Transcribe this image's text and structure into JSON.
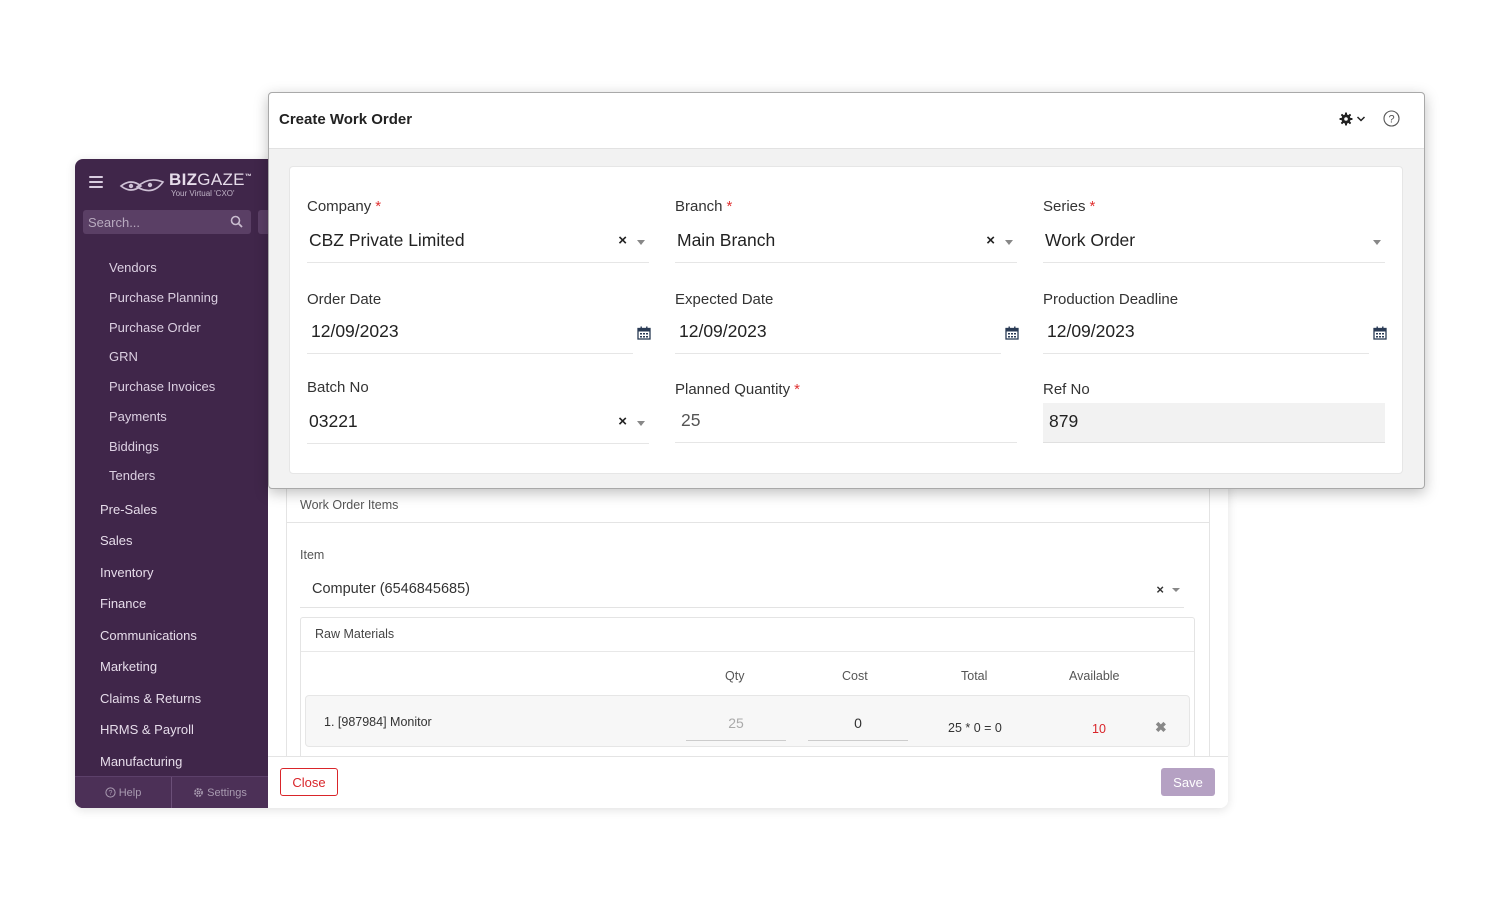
{
  "sidebar": {
    "logo": {
      "brand_bold": "BIZ",
      "brand_light": "GAZE",
      "tm": "™",
      "tagline": "Your Virtual 'CXO'"
    },
    "search_placeholder": "Search...",
    "sub_items": [
      "Vendors",
      "Purchase Planning",
      "Purchase Order",
      "GRN",
      "Purchase Invoices",
      "Payments",
      "Biddings",
      "Tenders"
    ],
    "main_items": [
      "Pre-Sales",
      "Sales",
      "Inventory",
      "Finance",
      "Communications",
      "Marketing",
      "Claims & Returns",
      "HRMS & Payroll",
      "Manufacturing"
    ],
    "footer": {
      "help": "Help",
      "settings": "Settings"
    }
  },
  "work_order_items": {
    "section_title": "Work Order Items",
    "item_label": "Item",
    "item_value": "Computer (6546845685)",
    "raw_materials": {
      "title": "Raw Materials",
      "headers": {
        "qty": "Qty",
        "cost": "Cost",
        "total": "Total",
        "available": "Available"
      },
      "rows": [
        {
          "name": "1. [987984] Monitor",
          "qty": "25",
          "cost": "0",
          "total": "25 * 0 = 0",
          "available": "10"
        }
      ]
    },
    "close_label": "Close",
    "save_label": "Save"
  },
  "modal": {
    "title": "Create Work Order",
    "fields": {
      "company": {
        "label": "Company",
        "value": "CBZ Private Limited",
        "required": "*"
      },
      "branch": {
        "label": "Branch",
        "value": "Main Branch",
        "required": "*"
      },
      "series": {
        "label": "Series",
        "value": "Work Order",
        "required": "*"
      },
      "order_date": {
        "label": "Order Date",
        "value": "12/09/2023"
      },
      "expected_date": {
        "label": "Expected Date",
        "value": "12/09/2023"
      },
      "production_deadline": {
        "label": "Production Deadline",
        "value": "12/09/2023"
      },
      "batch_no": {
        "label": "Batch No",
        "value": "03221"
      },
      "planned_quantity": {
        "label": "Planned Quantity",
        "value": "25",
        "required": "*"
      },
      "ref_no": {
        "label": "Ref No",
        "value": "879"
      }
    }
  },
  "colors": {
    "sidebar_bg": "#40264a",
    "required": "#e03131",
    "danger": "#d9252a",
    "save_button": "#b5a1c3"
  },
  "icons": [
    "menu-icon",
    "search-icon",
    "help-circle-icon",
    "gear-icon",
    "chevron-down-icon",
    "calendar-icon",
    "clear-icon",
    "remove-icon"
  ]
}
